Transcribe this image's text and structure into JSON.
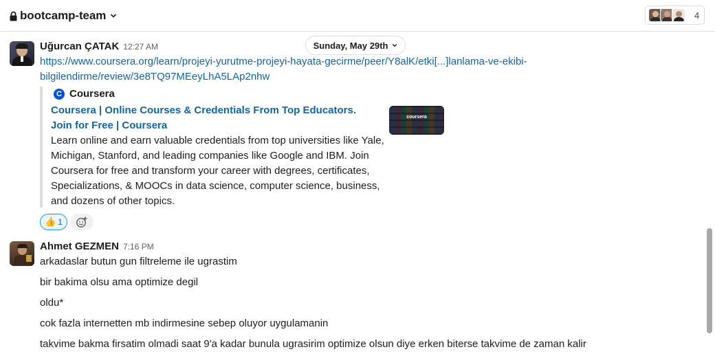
{
  "header": {
    "channel": "bootcamp-team",
    "member_count": "4"
  },
  "date_divider": "Sunday, May 29th",
  "messages": [
    {
      "sender": "Uğurcan ÇATAK",
      "time": "12:27 AM",
      "link_line1": "https://www.coursera.org/learn/projeyi-yurutme-projeyi-hayata-gecirme/peer/Y8alK/etki[...]lanlama-ve-ekibi-",
      "link_line2": "bilgilendirme/review/3e8TQ97MEeyLhA5LAp2nhw",
      "unfurl": {
        "site": "Coursera",
        "title": "Coursera | Online Courses & Credentials From Top Educators. Join for Free | Coursera",
        "description": "Learn online and earn valuable credentials from top universities like Yale, Michigan, Stanford, and leading companies like Google and IBM. Join Coursera for free and transform your career with degrees, certificates, Specializations, & MOOCs in data science, computer science, business, and dozens of other topics.",
        "thumbnail_label": "coursera"
      },
      "reaction": {
        "emoji": "👍",
        "count": "1"
      }
    },
    {
      "sender": "Ahmet GEZMEN",
      "time": "7:16 PM",
      "lines": [
        "arkadaslar butun gun filtreleme ile ugrastim",
        "bir bakima olsu ama optimize degil",
        "oldu*",
        "cok fazla internetten mb indirmesine sebep oluyor uygulamanin",
        "takvime bakma firsatim olmadi saat 9'a kadar bunula ugrasirim optimize olsun diye erken biterse takvime de zaman kalir"
      ]
    }
  ]
}
